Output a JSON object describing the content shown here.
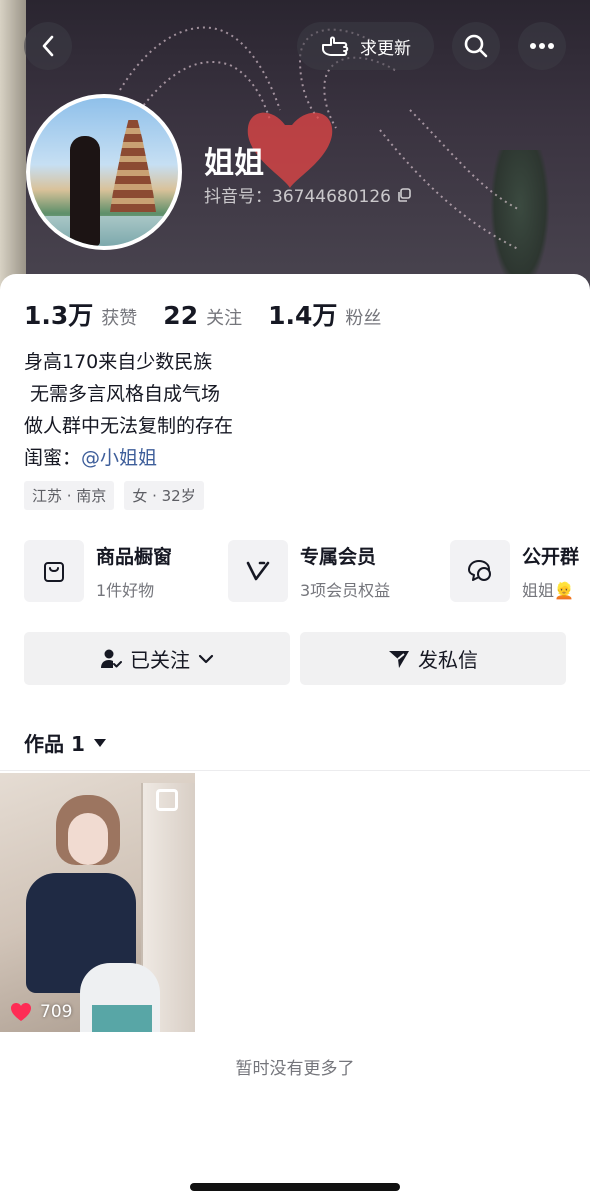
{
  "header": {
    "request_update_label": "求更新",
    "nickname": "姐姐",
    "douyin_id_label": "抖音号：36744680126"
  },
  "stats": [
    {
      "value": "1.3万",
      "label": "获赞"
    },
    {
      "value": "22",
      "label": "关注"
    },
    {
      "value": "1.4万",
      "label": "粉丝"
    }
  ],
  "bio": {
    "lines": [
      "身高170来自少数民族",
      " 无需多言风格自成气场",
      "做人群中无法复制的存在"
    ],
    "bestie_label": "闺蜜：",
    "bestie_mention": "@小姐姐"
  },
  "tags": [
    "江苏 · 南京",
    "女 · 32岁"
  ],
  "services": [
    {
      "title": "商品橱窗",
      "subtitle": "1件好物",
      "icon": "shopping-bag-icon"
    },
    {
      "title": "专属会员",
      "subtitle": "3项会员权益",
      "icon": "vip-v-icon"
    },
    {
      "title": "公开群",
      "subtitle": "姐姐👱",
      "icon": "chat-group-icon"
    }
  ],
  "actions": {
    "followed_label": "已关注",
    "message_label": "发私信"
  },
  "works": {
    "tab_label": "作品 1",
    "items": [
      {
        "likes": "709"
      }
    ],
    "end_text": "暂时没有更多了"
  },
  "colors": {
    "mention": "#3e5e9a",
    "like_heart": "#fe2c55",
    "secondary_text": "#75767c",
    "button_bg": "#f1f1f2"
  }
}
